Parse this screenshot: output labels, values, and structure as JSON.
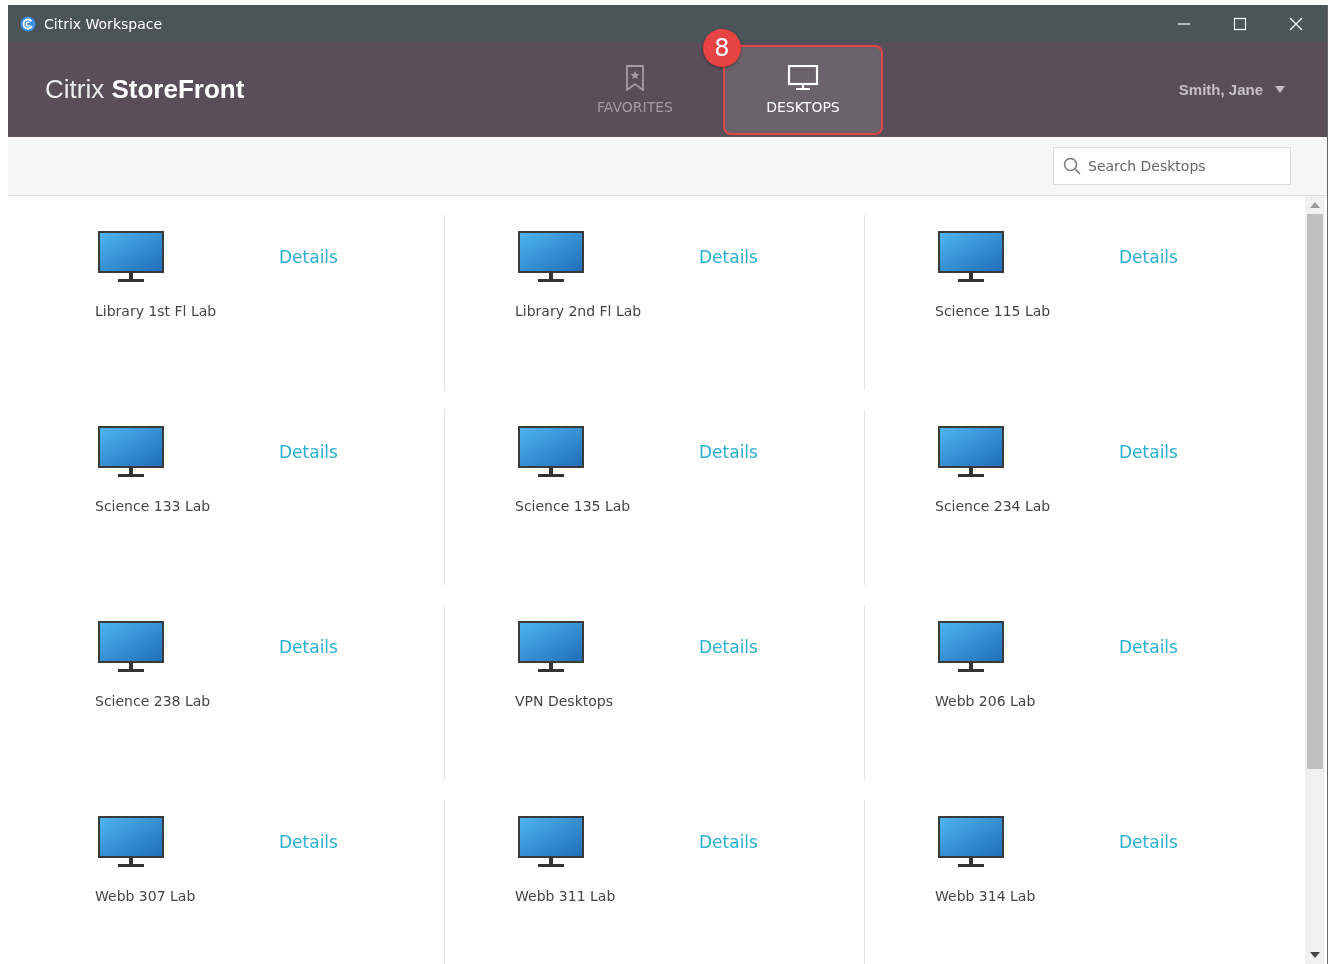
{
  "window": {
    "title": "Citrix Workspace"
  },
  "brand": {
    "light": "Citrix",
    "bold": "StoreFront"
  },
  "tabs": [
    {
      "label": "FAVORITES",
      "kind": "favorites",
      "selected": false
    },
    {
      "label": "DESKTOPS",
      "kind": "desktops",
      "selected": true
    }
  ],
  "callout": {
    "number": "8"
  },
  "user_menu": {
    "label": "Smith, Jane"
  },
  "search": {
    "placeholder": "Search Desktops"
  },
  "desktops": [
    {
      "name": "Library 1st Fl Lab",
      "action": "Details"
    },
    {
      "name": "Library 2nd Fl Lab",
      "action": "Details"
    },
    {
      "name": "Science 115 Lab",
      "action": "Details"
    },
    {
      "name": "Science 133 Lab",
      "action": "Details"
    },
    {
      "name": "Science 135 Lab",
      "action": "Details"
    },
    {
      "name": "Science 234 Lab",
      "action": "Details"
    },
    {
      "name": "Science 238 Lab",
      "action": "Details"
    },
    {
      "name": "VPN Desktops",
      "action": "Details"
    },
    {
      "name": "Webb 206 Lab",
      "action": "Details"
    },
    {
      "name": "Webb 307 Lab",
      "action": "Details"
    },
    {
      "name": "Webb 311 Lab",
      "action": "Details"
    },
    {
      "name": "Webb 314 Lab",
      "action": "Details"
    }
  ]
}
